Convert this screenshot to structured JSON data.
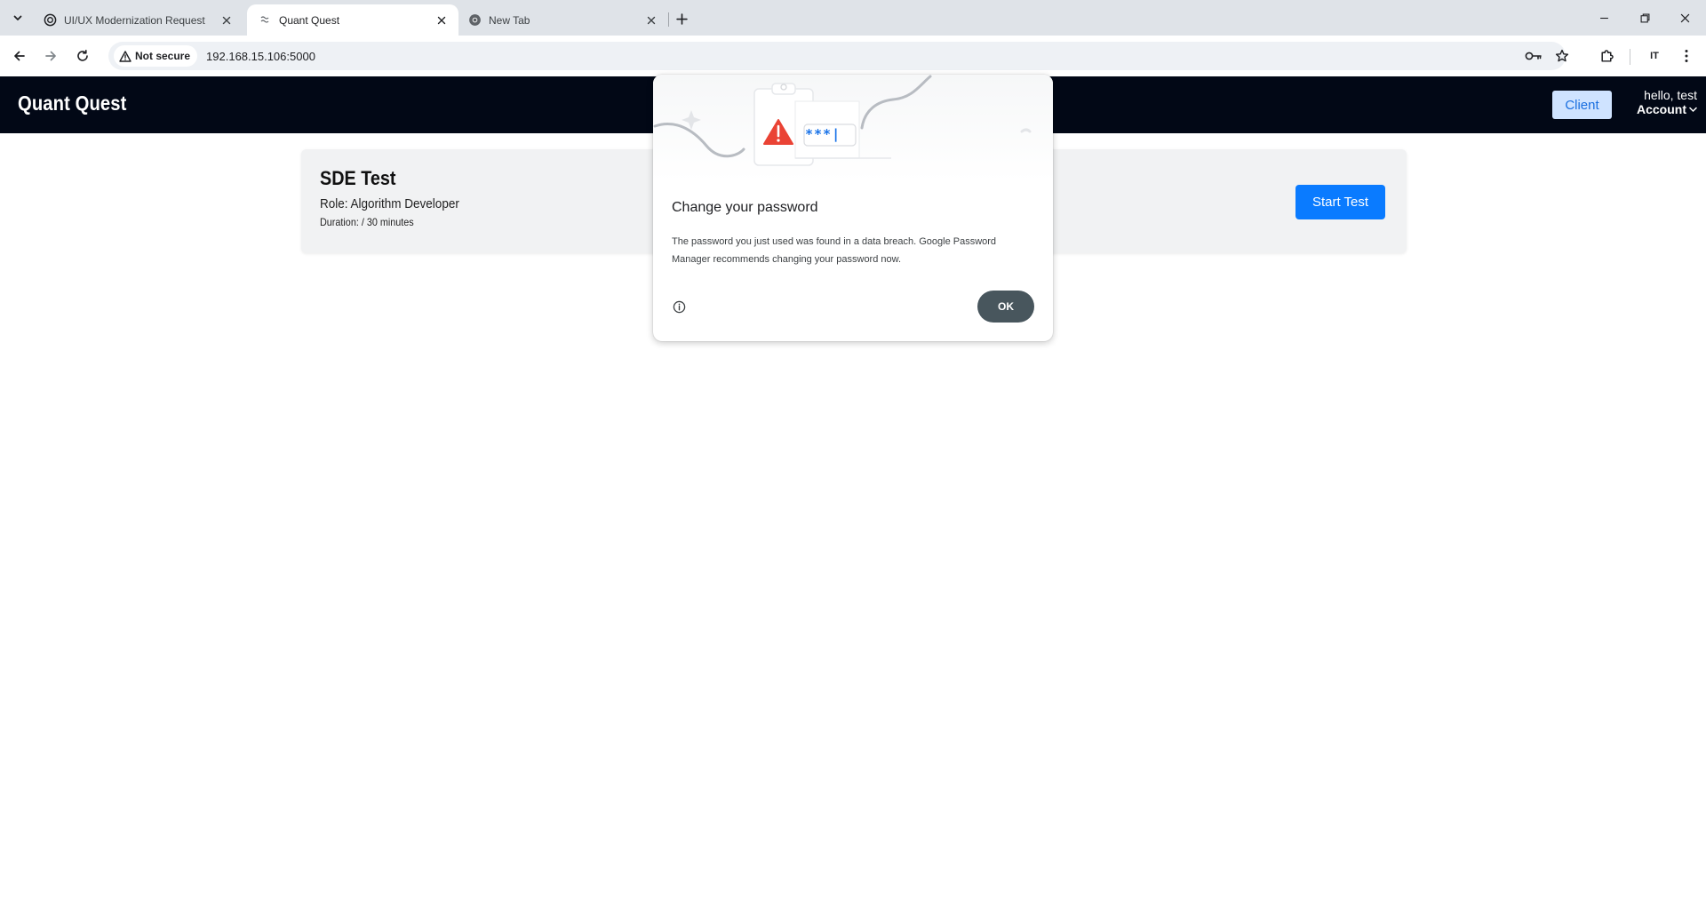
{
  "browser": {
    "tabs": [
      {
        "title": "UI/UX Modernization Request",
        "favicon": "openai-icon",
        "active": false
      },
      {
        "title": "Quant Quest",
        "favicon": "page-icon",
        "active": true
      },
      {
        "title": "New Tab",
        "favicon": "chrome-icon",
        "active": false
      }
    ],
    "address": {
      "security_label": "Not secure",
      "url": "192.168.15.106:5000"
    },
    "profile_label": "IT"
  },
  "app": {
    "brand": "Quant Quest",
    "client_label": "Client",
    "greeting": "hello, test",
    "account_label": "Account"
  },
  "test_card": {
    "title": "SDE Test",
    "role": "Role: Algorithm Developer",
    "duration": "Duration: / 30 minutes",
    "start_label": "Start Test"
  },
  "password_dialog": {
    "title": "Change your password",
    "body": "The password you just used was found in a data breach. Google Password Manager recommends changing your password now.",
    "ok_label": "OK",
    "masked_text": "***|"
  },
  "colors": {
    "header_bg": "#020816",
    "primary_blue": "#0a7bff",
    "client_bg": "#cfe3ff",
    "warning_red": "#ea4335",
    "ok_button": "#48565d"
  }
}
